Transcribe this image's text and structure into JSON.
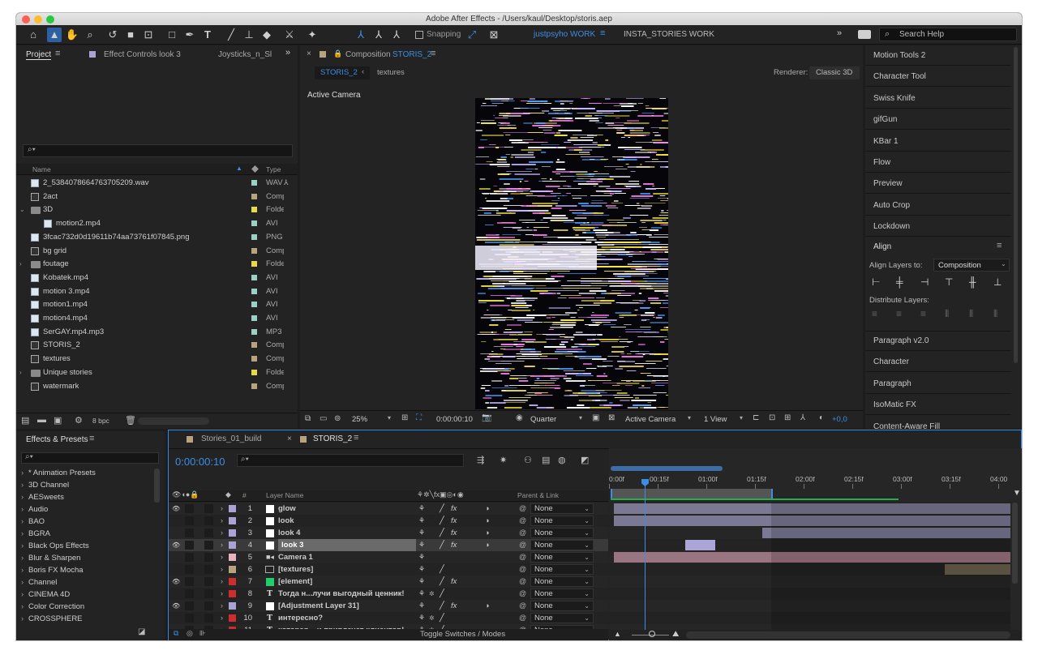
{
  "window": {
    "title": "Adobe After Effects - /Users/kaul/Desktop/storis.aep"
  },
  "toolbar": {
    "snapping": "Snapping",
    "workspace_active": "justpsyho WORK",
    "workspace_other": "INSTA_STORIES WORK",
    "search_placeholder": "Search Help"
  },
  "project": {
    "tabs": [
      "Project",
      "Effect Controls look 3",
      "Joysticks_n_Sl"
    ],
    "search_placeholder": "",
    "col_name": "Name",
    "col_type": "Type",
    "items": [
      {
        "name": "2_5384078664763705209.wav",
        "type": "WAV",
        "color": "#9bd0c4",
        "kind": "file",
        "indent": 0
      },
      {
        "name": "2act",
        "type": "Comp",
        "color": "#b8a37e",
        "kind": "comp",
        "indent": 0
      },
      {
        "name": "3D",
        "type": "Folder",
        "color": "#e6d94a",
        "kind": "folder",
        "indent": 0,
        "open": true
      },
      {
        "name": "motion2.mp4",
        "type": "AVI",
        "color": "#9bd0c4",
        "kind": "file",
        "indent": 1
      },
      {
        "name": "3fcac732d0d19611b74aa73761f07845.png",
        "type": "PNG",
        "color": "#9bd0c4",
        "kind": "file",
        "indent": 0
      },
      {
        "name": "bg grid",
        "type": "Comp",
        "color": "#b8a37e",
        "kind": "comp",
        "indent": 0
      },
      {
        "name": "foutage",
        "type": "Folder",
        "color": "#e6d94a",
        "kind": "folder",
        "indent": 0,
        "open": false
      },
      {
        "name": "Kobatek.mp4",
        "type": "AVI",
        "color": "#9bd0c4",
        "kind": "file",
        "indent": 0
      },
      {
        "name": "motion 3.mp4",
        "type": "AVI",
        "color": "#9bd0c4",
        "kind": "file",
        "indent": 0
      },
      {
        "name": "motion1.mp4",
        "type": "AVI",
        "color": "#9bd0c4",
        "kind": "file",
        "indent": 0
      },
      {
        "name": "motion4.mp4",
        "type": "AVI",
        "color": "#9bd0c4",
        "kind": "file",
        "indent": 0
      },
      {
        "name": "SerGAY.mp4.mp3",
        "type": "MP3",
        "color": "#9bd0c4",
        "kind": "file",
        "indent": 0
      },
      {
        "name": "STORIS_2",
        "type": "Comp",
        "color": "#b8a37e",
        "kind": "comp",
        "indent": 0
      },
      {
        "name": "textures",
        "type": "Comp",
        "color": "#b8a37e",
        "kind": "comp",
        "indent": 0
      },
      {
        "name": "Unique stories",
        "type": "Folder",
        "color": "#e6d94a",
        "kind": "folder",
        "indent": 0,
        "open": false
      },
      {
        "name": "watermark",
        "type": "Comp",
        "color": "#b8a37e",
        "kind": "comp",
        "indent": 0
      }
    ],
    "bpc": "8 bpc"
  },
  "composition": {
    "tab_label": "Composition",
    "tab_name": "STORIS_2",
    "crumb_active": "STORIS_2",
    "crumb_next": "textures",
    "renderer_label": "Renderer:",
    "renderer_value": "Classic 3D",
    "view_label": "Active Camera",
    "zoom": "25%",
    "timecode": "0:00:00:10",
    "resolution": "Quarter",
    "camera": "Active Camera",
    "views": "1 View",
    "exposure": "+0,0"
  },
  "right_panel": {
    "items_top": [
      "Motion Tools 2",
      "Character Tool",
      "Swiss Knife",
      "gifGun",
      "KBar 1",
      "Flow",
      "Preview",
      "Auto Crop",
      "Lockdown"
    ],
    "align_title": "Align",
    "align_layers_to": "Align Layers to:",
    "align_target": "Composition",
    "distribute_layers": "Distribute Layers:",
    "items_bottom": [
      "Paragraph v2.0",
      "Character",
      "Paragraph",
      "IsoMatic FX",
      "Content-Aware Fill"
    ]
  },
  "effects": {
    "title": "Effects & Presets",
    "items": [
      "* Animation Presets",
      "3D Channel",
      "AESweets",
      "Audio",
      "BAO",
      "BGRA",
      "Black Ops Effects",
      "Blur & Sharpen",
      "Boris FX Mocha",
      "Channel",
      "CINEMA 4D",
      "Color Correction",
      "CROSSPHERE"
    ]
  },
  "timeline": {
    "tabs": [
      "Stories_01_build",
      "STORIS_2"
    ],
    "timecode": "0:00:00:10",
    "col_layer_name": "Layer Name",
    "col_parent": "Parent & Link",
    "col_num": "#",
    "toggle_label": "Toggle Switches / Modes",
    "ruler": [
      "0:00f",
      "00:15f",
      "01:00f",
      "01:15f",
      "02:00f",
      "02:15f",
      "03:00f",
      "03:15f",
      "04:00"
    ],
    "layers": [
      {
        "num": "1",
        "name": "glow",
        "color": "#a9a3d6",
        "kind": "solid",
        "swatch": "#ffffff",
        "parent": "None",
        "fx": true,
        "adj": true,
        "bar_start": 0.0,
        "bar_end": 1.0,
        "bar_color": "#7b7893"
      },
      {
        "num": "2",
        "name": "look",
        "color": "#a9a3d6",
        "kind": "solid",
        "swatch": "#ffffff",
        "parent": "None",
        "fx": true,
        "adj": true,
        "bar_start": 0.0,
        "bar_end": 1.0,
        "bar_color": "#7b7893"
      },
      {
        "num": "3",
        "name": "look 4",
        "color": "#a9a3d6",
        "kind": "solid",
        "swatch": "#ffffff",
        "parent": "None",
        "fx": true,
        "adj": true,
        "bar_start": 0.375,
        "bar_end": 1.0,
        "bar_color": "#7b7893"
      },
      {
        "num": "4",
        "name": "look 3",
        "color": "#a9a3d6",
        "kind": "solid",
        "swatch": "#ffffff",
        "parent": "None",
        "fx": true,
        "adj": true,
        "bar_start": 0.18,
        "bar_end": 0.255,
        "bar_color": "#aca6d8",
        "selected": true
      },
      {
        "num": "5",
        "name": "Camera 1",
        "color": "#e8b2bf",
        "kind": "camera",
        "swatch": "",
        "parent": "None",
        "fx": false,
        "adj": false,
        "bar_start": 0.0,
        "bar_end": 1.0,
        "bar_color": "#9a7480"
      },
      {
        "num": "6",
        "name": "[textures]",
        "color": "#b8a37e",
        "kind": "comp",
        "swatch": "",
        "parent": "None",
        "fx": false,
        "adj": false,
        "bar_start": 0.835,
        "bar_end": 1.0,
        "bar_color": "#6b604d"
      },
      {
        "num": "7",
        "name": "[element]",
        "color": "#cc2e2e",
        "kind": "solid",
        "swatch": "#1ecf6b",
        "parent": "None",
        "fx": true,
        "adj": false,
        "bar_start": 0,
        "bar_end": 0,
        "bar_color": "#3a3a3a"
      },
      {
        "num": "8",
        "name": "Тогда н...лучи выгодный ценник!",
        "color": "#cc2e2e",
        "kind": "text",
        "swatch": "",
        "parent": "None",
        "fx": false,
        "adj": false,
        "bar_start": 0,
        "bar_end": 0,
        "bar_color": "#3a3a3a"
      },
      {
        "num": "9",
        "name": "[Adjustment Layer 31]",
        "color": "#a9a3d6",
        "kind": "solid",
        "swatch": "#ffffff",
        "parent": "None",
        "fx": true,
        "adj": true,
        "bar_start": 0,
        "bar_end": 0,
        "bar_color": "#3a3a3a"
      },
      {
        "num": "10",
        "name": "интересно?",
        "color": "#cc2e2e",
        "kind": "text",
        "swatch": "",
        "parent": "None",
        "fx": false,
        "adj": false,
        "bar_start": 0,
        "bar_end": 0,
        "bar_color": "#3a3a3a"
      },
      {
        "num": "11",
        "name": "которая... и привлечет клиентов!",
        "color": "#cc2e2e",
        "kind": "text",
        "swatch": "",
        "parent": "None",
        "fx": false,
        "adj": false,
        "bar_start": 0,
        "bar_end": 0,
        "bar_color": "#3a3a3a"
      }
    ]
  },
  "colors": {
    "accent": "#2d8ceb",
    "panel": "#232323",
    "bg": "#1d1d1d"
  }
}
